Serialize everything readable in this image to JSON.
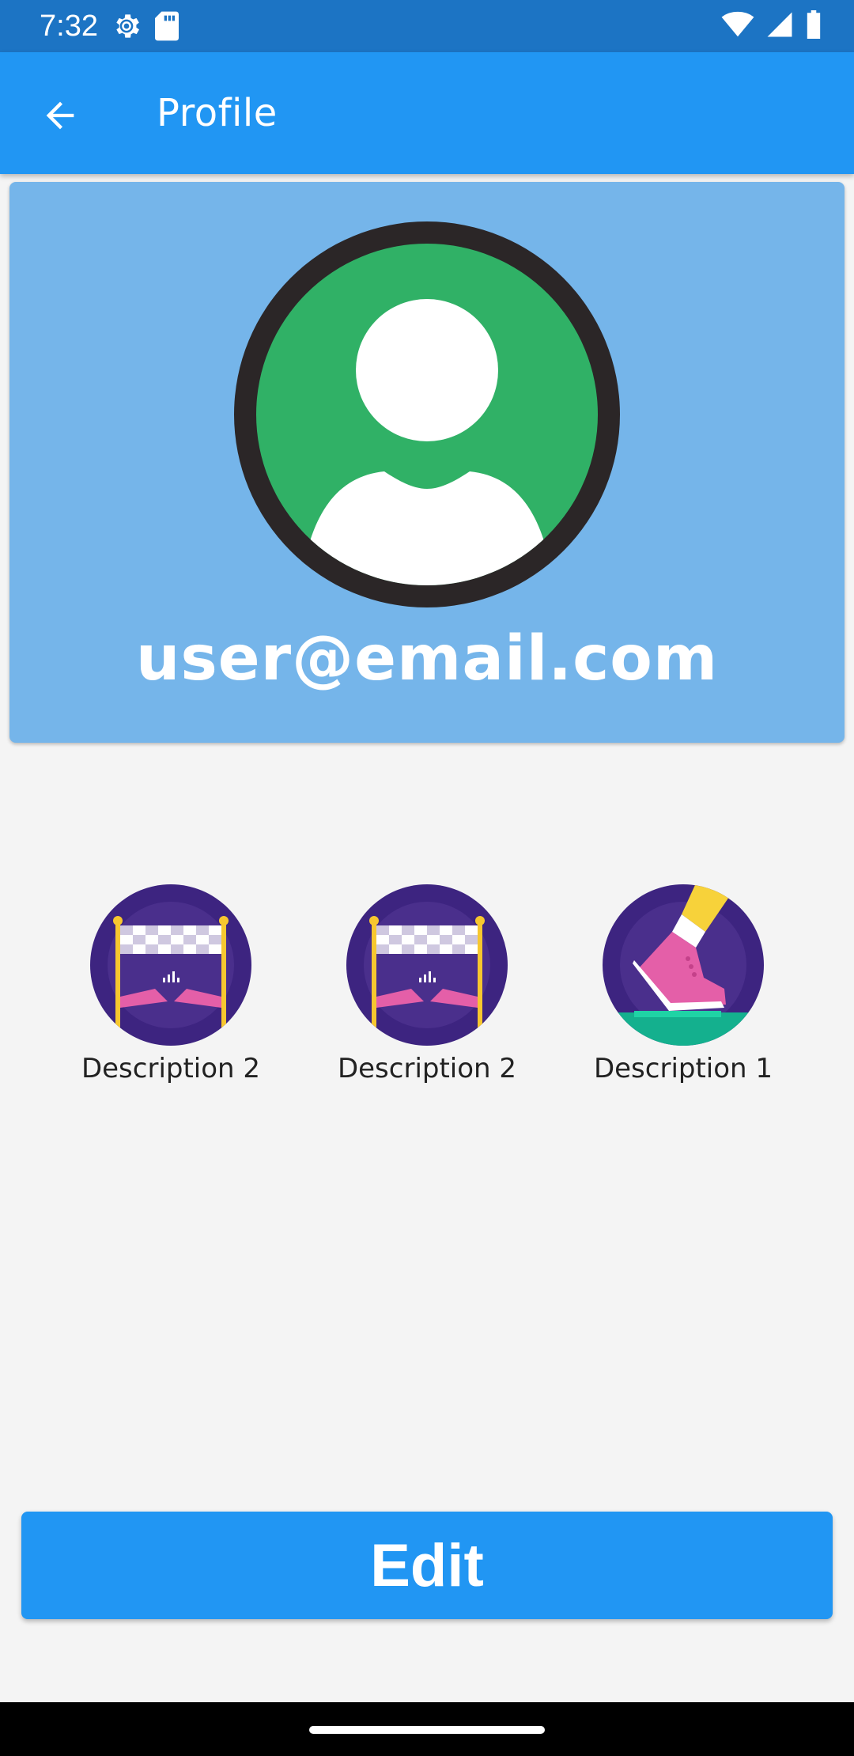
{
  "status_bar": {
    "time": "7:32",
    "left_icons": [
      "settings-gear-icon",
      "sd-card-icon"
    ],
    "right_icons": [
      "wifi-icon",
      "signal-icon",
      "battery-icon"
    ]
  },
  "app_bar": {
    "back_icon": "arrow-back-icon",
    "title": "Profile"
  },
  "profile": {
    "avatar_icon": "person-avatar-icon",
    "email": "user@email.com"
  },
  "badges": [
    {
      "icon": "finish-line-badge-icon",
      "label": "Description 2"
    },
    {
      "icon": "finish-line-badge-icon",
      "label": "Description 2"
    },
    {
      "icon": "running-shoe-badge-icon",
      "label": "Description 1"
    }
  ],
  "actions": {
    "edit_label": "Edit"
  },
  "colors": {
    "status_bar": "#1c74c4",
    "app_bar": "#2196f3",
    "card": "#75b5ea",
    "avatar_green": "#30b166",
    "badge_purple": "#442a84",
    "background": "#f4f4f4"
  }
}
